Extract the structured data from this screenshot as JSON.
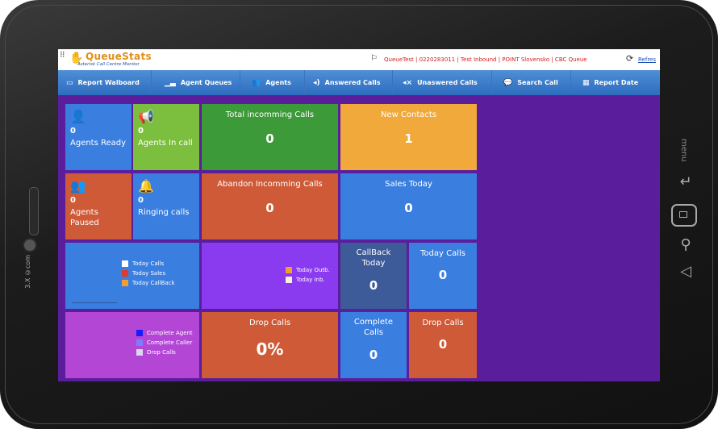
{
  "app": {
    "logo_title": "QueueStats",
    "logo_subtitle": "Asterisk Call Centre Monitor",
    "queue_info": "QueueTest | 0220283011 | Test Inbound | POINT Slovensko | CBC Queue",
    "refresh_label": "Refres"
  },
  "device": {
    "brand": "3.X ©com",
    "menu_label": "menu"
  },
  "nav": [
    {
      "label": "Report Walboard",
      "icon": "monitor-icon"
    },
    {
      "label": "Agent Queues",
      "icon": "bar-chart-icon"
    },
    {
      "label": "Agents",
      "icon": "users-icon"
    },
    {
      "label": "Answered Calls",
      "icon": "speaker-icon"
    },
    {
      "label": "Unaswered Calls",
      "icon": "mute-icon"
    },
    {
      "label": "Search Call",
      "icon": "chat-icon"
    },
    {
      "label": "Report Date",
      "icon": "calendar-icon"
    }
  ],
  "tiles": {
    "agents_ready": {
      "value": "0",
      "label": "Agents Ready",
      "icon": "user-icon"
    },
    "agents_in_call": {
      "value": "0",
      "label": "Agents In call",
      "icon": "megaphone-icon"
    },
    "total_incoming": {
      "title": "Total incomming Calls",
      "value": "0"
    },
    "new_contacts": {
      "title": "New Contacts",
      "value": "1"
    },
    "agents_paused": {
      "value": "0",
      "label_line1": "Agents",
      "label_line2": "Paused",
      "icon": "users-outline-icon"
    },
    "ringing_calls": {
      "value": "0",
      "label": "Ringing calls",
      "icon": "bell-icon"
    },
    "abandon_incoming": {
      "title": "Abandon Incomming Calls",
      "value": "0"
    },
    "sales_today": {
      "title": "Sales Today",
      "value": "0"
    },
    "callback_today": {
      "title_line1": "CallBack",
      "title_line2": "Today",
      "value": "0"
    },
    "today_calls": {
      "title": "Today Calls",
      "value": "0"
    },
    "drop_calls_pct": {
      "title": "Drop Calls",
      "value": "0%"
    },
    "complete_calls": {
      "title_line1": "Complete",
      "title_line2": "Calls",
      "value": "0"
    },
    "drop_calls": {
      "title": "Drop Calls",
      "value": "0"
    }
  },
  "legends": {
    "chart1": [
      {
        "label": "Today Calls",
        "color": "#ffffff"
      },
      {
        "label": "Today Sales",
        "color": "#e03a2f"
      },
      {
        "label": "Today CallBack",
        "color": "#f0a030"
      }
    ],
    "chart2": [
      {
        "label": "Today Outb.",
        "color": "#f0a030"
      },
      {
        "label": "Today Inb.",
        "color": "#f8f0d8"
      }
    ],
    "chart3": [
      {
        "label": "Complete Agent",
        "color": "#1a1aff"
      },
      {
        "label": "Complete Caller",
        "color": "#7c7cff"
      },
      {
        "label": "Drop Calls",
        "color": "#d8d8f0"
      }
    ]
  },
  "colors": {
    "blue": "#3a7ee0",
    "green": "#7cbf3e",
    "dark_green": "#3c9a38",
    "orange": "#f2a93b",
    "red_orange": "#cf5a38",
    "slate": "#3d5a99",
    "violet": "#8a3bf0",
    "magenta": "#b446d6",
    "screen_bg": "#5a1d9c"
  }
}
